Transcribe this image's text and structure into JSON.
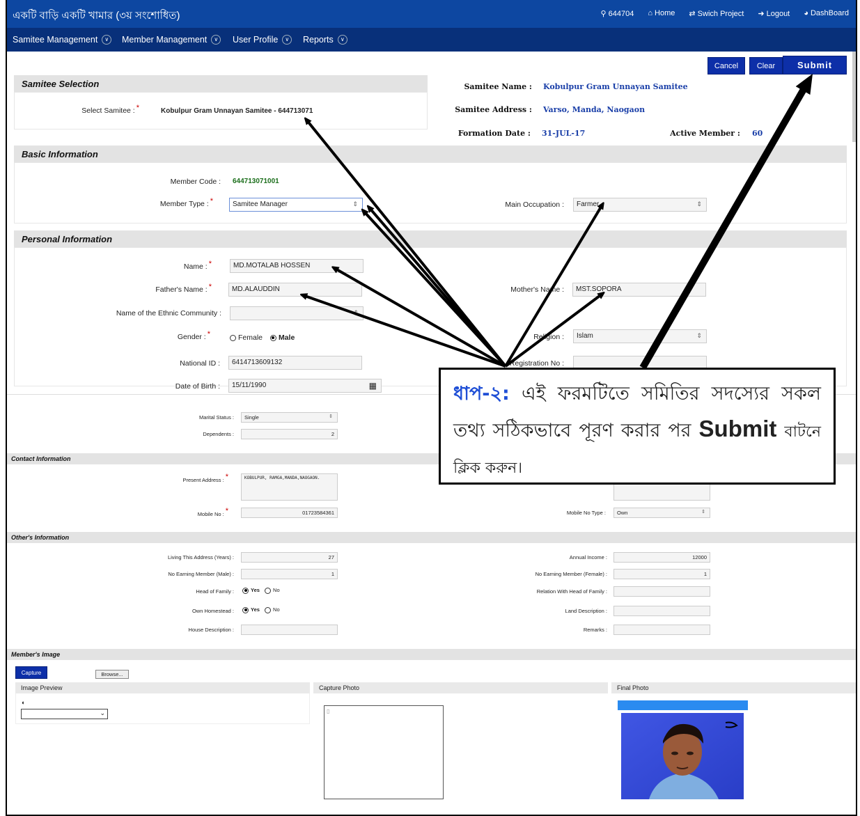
{
  "header": {
    "app_title": "একটি বাড়ি একটি খামার (৩য় সংশোধিত)",
    "user_code": "644704",
    "home": "Home",
    "switch_project": "Swich Project",
    "logout": "Logout",
    "dashboard": "DashBoard"
  },
  "menu": {
    "items": [
      {
        "label": "Samitee Management"
      },
      {
        "label": "Member Management"
      },
      {
        "label": "User Profile"
      },
      {
        "label": "Reports"
      }
    ]
  },
  "actions": {
    "cancel": "Cancel",
    "clear": "Clear",
    "submit": "Submit"
  },
  "samitee_selection": {
    "title": "Samitee Selection",
    "select_label": "Select Samitee :",
    "selected_value": "Kobulpur Gram Unnayan Samitee - 644713071"
  },
  "samitee_info": {
    "name_label": "Samitee Name :",
    "name_value": "Kobulpur Gram Unnayan Samitee",
    "address_label": "Samitee Address :",
    "address_value": "Varso, Manda, Naogaon",
    "formation_label": "Formation Date :",
    "formation_value": "31-JUL-17",
    "active_label": "Active Member :",
    "active_value": "60"
  },
  "basic_info": {
    "title": "Basic Information",
    "member_code_label": "Member Code :",
    "member_code_value": "644713071001",
    "member_type_label": "Member Type :",
    "member_type_value": "Samitee Manager",
    "main_occupation_label": "Main Occupation :",
    "main_occupation_value": "Farmer"
  },
  "personal_info": {
    "title": "Personal Information",
    "name_label": "Name :",
    "name_value": "MD.MOTALAB HOSSEN",
    "father_label": "Father's Name :",
    "father_value": "MD.ALAUDDIN",
    "mother_label": "Mother's Name :",
    "mother_value": "MST.SOPORA",
    "ethnic_label": "Name of the Ethnic Community :",
    "gender_label": "Gender :",
    "gender_female": "Female",
    "gender_male": "Male",
    "religion_label": "Religion :",
    "religion_value": "Islam",
    "nid_label": "National ID :",
    "nid_value": "6414713609132",
    "reg_label": "Registration No :",
    "dob_label": "Date of Birth :",
    "dob_value": "15/11/1990",
    "marital_label": "Marital Status :",
    "marital_value": "Single",
    "dependents_label": "Dependents :",
    "dependents_value": "2"
  },
  "contact_info": {
    "title": "Contact Information",
    "present_address_label": "Present Address :",
    "present_address_value": "KOBULPUR, RAMGA,MANDA,NAOGAON.",
    "mobile_label": "Mobile No :",
    "mobile_value": "01723584361",
    "mobile_type_label": "Mobile No Type :",
    "mobile_type_value": "Own"
  },
  "others_info": {
    "title": "Other's Information",
    "living_label": "Living This Address (Years) :",
    "living_value": "27",
    "annual_income_label": "Annual Income :",
    "annual_income_value": "12000",
    "earning_male_label": "No Earning Member (Male) :",
    "earning_male_value": "1",
    "earning_female_label": "No Earning Member (Female) :",
    "earning_female_value": "1",
    "head_family_label": "Head of Family :",
    "yes": "Yes",
    "no": "No",
    "relation_label": "Relation With Head of Family :",
    "own_homestead_label": "Own Homestead :",
    "land_desc_label": "Land Description :",
    "house_desc_label": "House Description :",
    "remarks_label": "Remarks :"
  },
  "member_image": {
    "title": "Member's Image",
    "capture_btn": "Capture",
    "browse_btn": "Browse...",
    "preview_title": "Image Preview",
    "capture_title": "Capture Photo",
    "final_title": "Final Photo"
  },
  "callout": {
    "step": "ধাপ-২:",
    "text": "এই ফরমটিতে সমিতির সদস্যের সকল তথ্য সঠিকভাবে পূরণ করার পর",
    "submit_word": "Submit",
    "tail": "বাটনে ক্লিক করুন।"
  },
  "colors": {
    "primary": "#0d47a1",
    "menu": "#08307a",
    "button": "#0d2fa8",
    "link_value": "#1a3fa8",
    "code_green": "#1b6e1b"
  }
}
